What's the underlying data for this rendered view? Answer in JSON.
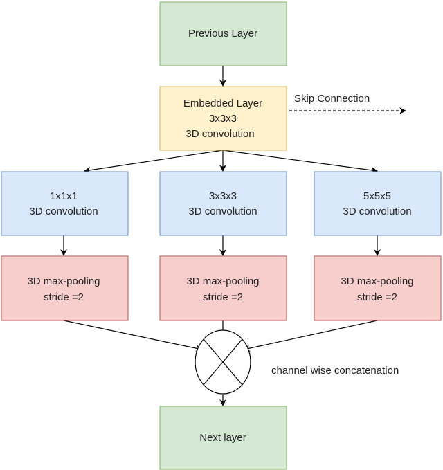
{
  "colors": {
    "green_fill": "#d5e8d4",
    "green_stroke": "#82b366",
    "yellow_fill": "#fff2cc",
    "yellow_stroke": "#d6b656",
    "blue_fill": "#dae8fc",
    "blue_stroke": "#6c8ebf",
    "red_fill": "#f8cecc",
    "red_stroke": "#b85450"
  },
  "nodes": {
    "previous": {
      "lines": [
        "Previous Layer"
      ]
    },
    "embedded": {
      "lines": [
        "Embedded Layer",
        "3x3x3",
        "3D convolution"
      ]
    },
    "conv1": {
      "lines": [
        "1x1x1",
        "3D convolution"
      ]
    },
    "conv3": {
      "lines": [
        "3x3x3",
        "3D convolution"
      ]
    },
    "conv5": {
      "lines": [
        "5x5x5",
        "3D convolution"
      ]
    },
    "pool1": {
      "lines": [
        "3D max-pooling",
        "stride =2"
      ]
    },
    "pool2": {
      "lines": [
        "3D max-pooling",
        "stride =2"
      ]
    },
    "pool3": {
      "lines": [
        "3D max-pooling",
        "stride =2"
      ]
    },
    "next": {
      "lines": [
        "Next layer"
      ]
    }
  },
  "labels": {
    "skip": "Skip Connection",
    "concat": "channel wise concatenation"
  }
}
